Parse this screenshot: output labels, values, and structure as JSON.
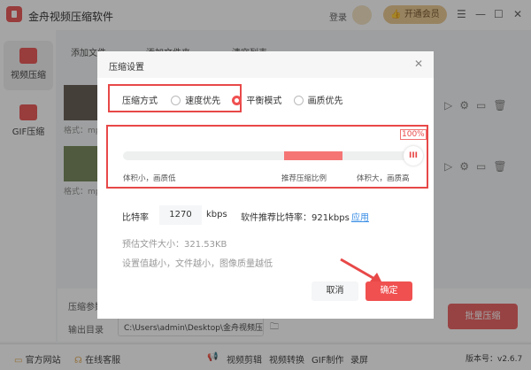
{
  "app": {
    "title": "金舟视频压缩软件",
    "login": "登录",
    "vip": "开通会员"
  },
  "sidebar": {
    "items": [
      {
        "label": "视频压缩"
      },
      {
        "label": "GIF压缩"
      }
    ]
  },
  "toolbar": {
    "add_file": "添加文件",
    "add_folder": "添加文件夹",
    "clear_list": "清空列表"
  },
  "files": [
    {
      "format": "格式：mp"
    },
    {
      "format": "格式：mp"
    }
  ],
  "bottom": {
    "params_label": "压缩参数",
    "output_label": "输出目录",
    "output_path": "C:\\Users\\admin\\Desktop\\金舟视频压缩软件",
    "batch_button": "批量压缩"
  },
  "footer": {
    "website": "官方网站",
    "support": "在线客服",
    "links": [
      "视频剪辑",
      "视频转换",
      "GIF制作",
      "录屏"
    ],
    "version": "版本号：v2.6.7"
  },
  "dialog": {
    "title": "压缩设置",
    "mode_label": "压缩方式",
    "modes": [
      {
        "label": "速度优先",
        "selected": false
      },
      {
        "label": "平衡模式",
        "selected": true
      },
      {
        "label": "画质优先",
        "selected": false
      }
    ],
    "slider": {
      "value_label": "100%",
      "value_percent": 100,
      "recommended_range_percent": [
        55,
        75
      ],
      "left_label": "体积小，画质低",
      "middle_label": "推荐压缩比例",
      "right_label": "体积大，画质高"
    },
    "bitrate_label": "比特率",
    "bitrate_value": "1270",
    "bitrate_unit": "kbps",
    "recommend_text": "软件推荐比特率：921kbps",
    "apply_link": "应用",
    "estimate": "预估文件大小：321.53KB",
    "hint": "设置值越小，文件越小，图像质量越低",
    "cancel": "取消",
    "confirm": "确定"
  },
  "colors": {
    "accent": "#f05050"
  }
}
